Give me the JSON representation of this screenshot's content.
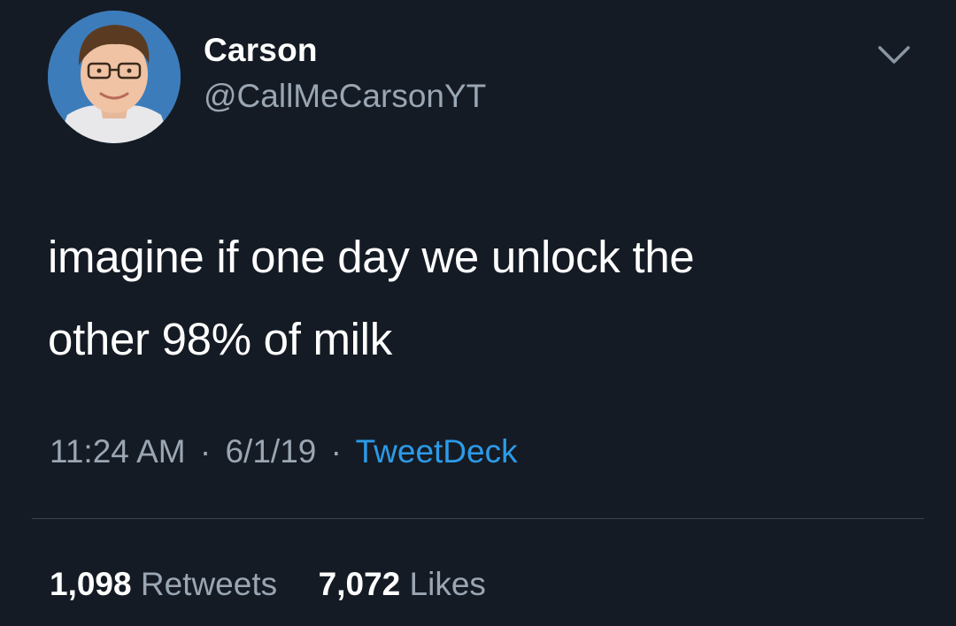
{
  "author": {
    "display_name": "Carson",
    "handle": "@CallMeCarsonYT",
    "avatar_icon": "profile-photo"
  },
  "menu": {
    "icon": "chevron-down-icon"
  },
  "tweet": {
    "text_line_1": "imagine if one day we unlock the",
    "text_line_2": "other 98% of milk"
  },
  "meta": {
    "time": "11:24 AM",
    "separator": "·",
    "date": "6/1/19",
    "source": "TweetDeck"
  },
  "stats": {
    "retweets_count": "1,098",
    "retweets_label": "Retweets",
    "likes_count": "7,072",
    "likes_label": "Likes"
  },
  "colors": {
    "background": "#151b24",
    "primary_text": "#ffffff",
    "secondary_text": "#9aa6b3",
    "link": "#2c9be9"
  }
}
